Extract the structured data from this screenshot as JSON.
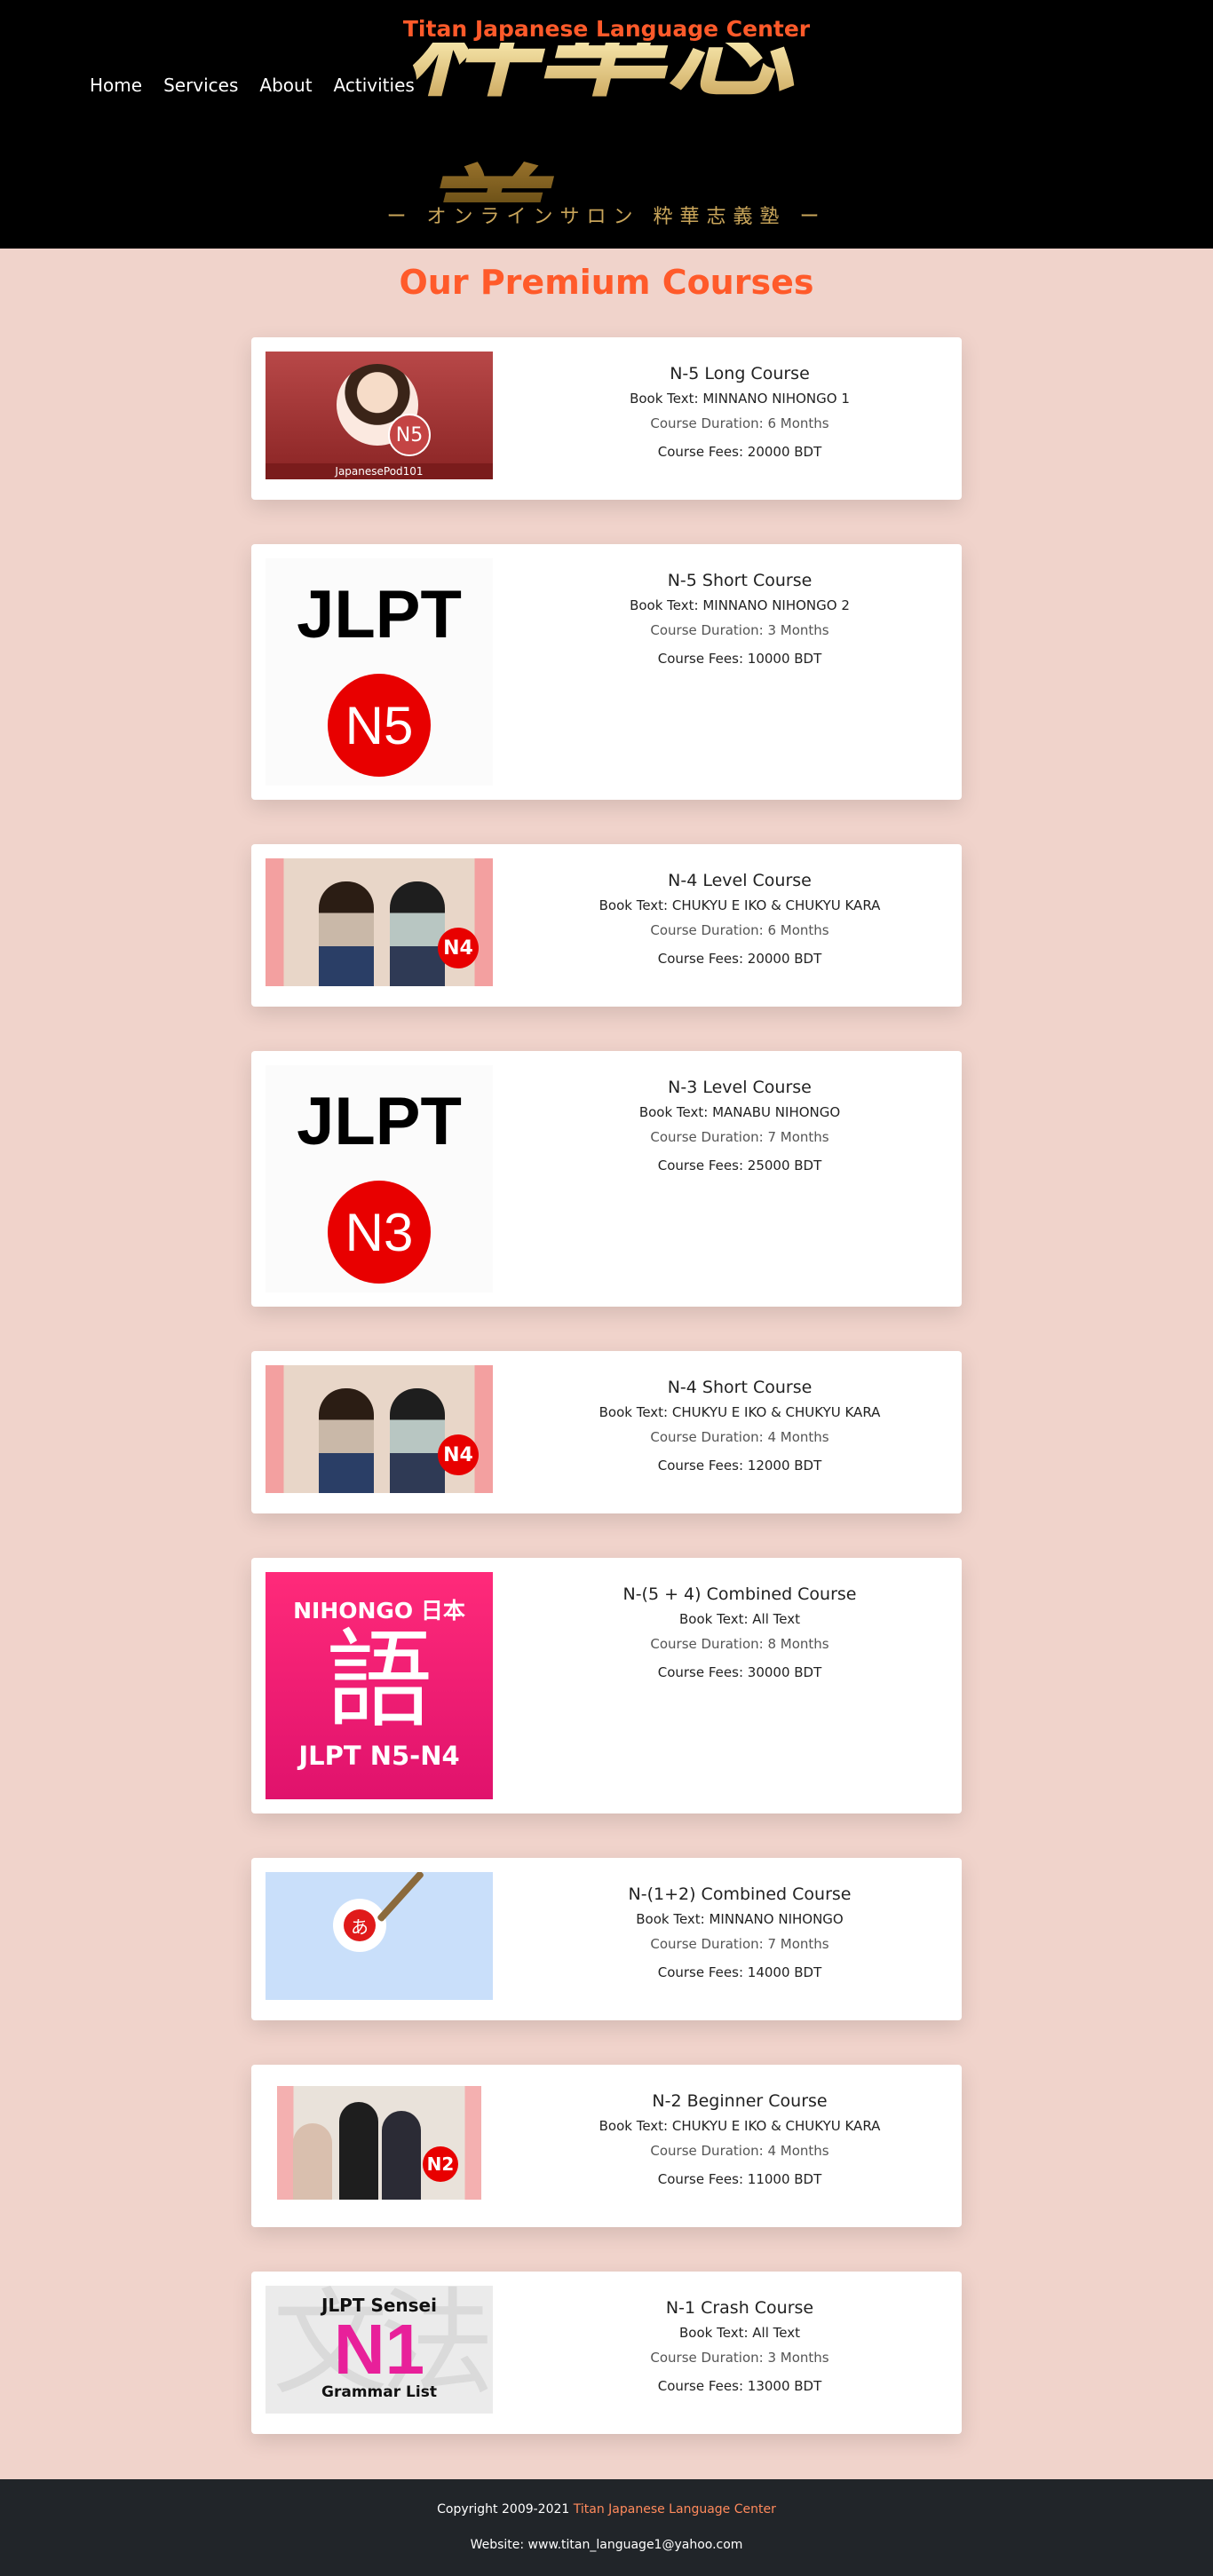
{
  "header": {
    "brand": "Titan Japanese Language Center",
    "nav": [
      "Home",
      "Services",
      "About",
      "Activities"
    ],
    "calligraphy": "粋華志義",
    "tagline": "ー オンラインサロン 粋華志義塾 ー"
  },
  "main": {
    "title": "Our Premium Courses",
    "courses": [
      {
        "title": "N-5 Long Course",
        "book": "Book Text: MINNANO NIHONGO 1",
        "duration": "Course Duration: 6 Months",
        "fees": "Course Fees: 20000 BDT",
        "thumb": "japanesepod-n5",
        "thumb_badge": "N5",
        "thumb_caption": "JapanesePod101"
      },
      {
        "title": "N-5 Short Course",
        "book": "Book Text: MINNANO NIHONGO 2",
        "duration": "Course Duration: 3 Months",
        "fees": "Course Fees: 10000 BDT",
        "thumb": "jlpt-n5",
        "thumb_word": "JLPT",
        "thumb_badge": "N5"
      },
      {
        "title": "N-4 Level Course",
        "book": "Book Text: CHUKYU E IKO & CHUKYU KARA",
        "duration": "Course Duration: 6 Months",
        "fees": "Course Fees: 20000 BDT",
        "thumb": "photo-n4",
        "thumb_badge": "N4"
      },
      {
        "title": "N-3 Level Course",
        "book": "Book Text: MANABU NIHONGO",
        "duration": "Course Duration: 7 Months",
        "fees": "Course Fees: 25000 BDT",
        "thumb": "jlpt-n3",
        "thumb_word": "JLPT",
        "thumb_badge": "N3"
      },
      {
        "title": "N-4 Short Course",
        "book": "Book Text: CHUKYU E IKO & CHUKYU KARA",
        "duration": "Course Duration: 4 Months",
        "fees": "Course Fees: 12000 BDT",
        "thumb": "photo-n4",
        "thumb_badge": "N4"
      },
      {
        "title": "N-(5 + 4) Combined Course",
        "book": "Book Text: All Text",
        "duration": "Course Duration: 8 Months",
        "fees": "Course Fees: 30000 BDT",
        "thumb": "nihongo",
        "thumb_line1": "NIHONGO 日本",
        "thumb_line2": "語",
        "thumb_line3": "JLPT N5-N4"
      },
      {
        "title": "N-(1+2) Combined Course",
        "book": "Book Text: MINNANO NIHONGO",
        "duration": "Course Duration: 7 Months",
        "fees": "Course Fees: 14000 BDT",
        "thumb": "brush",
        "thumb_badge": "あ"
      },
      {
        "title": "N-2 Beginner Course",
        "book": "Book Text: CHUKYU E IKO & CHUKYU KARA",
        "duration": "Course Duration: 4 Months",
        "fees": "Course Fees: 11000 BDT",
        "thumb": "office-n2",
        "thumb_badge": "N2"
      },
      {
        "title": "N-1 Crash Course",
        "book": "Book Text: All Text",
        "duration": "Course Duration: 3 Months",
        "fees": "Course Fees: 13000 BDT",
        "thumb": "sensei-n1",
        "thumb_line1": "JLPT Sensei",
        "thumb_line2": "N1",
        "thumb_line3": "Grammar List",
        "thumb_bg": "文法"
      }
    ]
  },
  "footer": {
    "copyright_prefix": "Copyright 2009-2021",
    "copyright_name": "Titan Japanese Language Center",
    "website": "Website: www.titan_language1@yahoo.com"
  },
  "colors": {
    "accent": "#ff5a2a",
    "page_bg": "#f0d3cb",
    "header_bg": "#000000",
    "footer_bg": "#212529"
  }
}
